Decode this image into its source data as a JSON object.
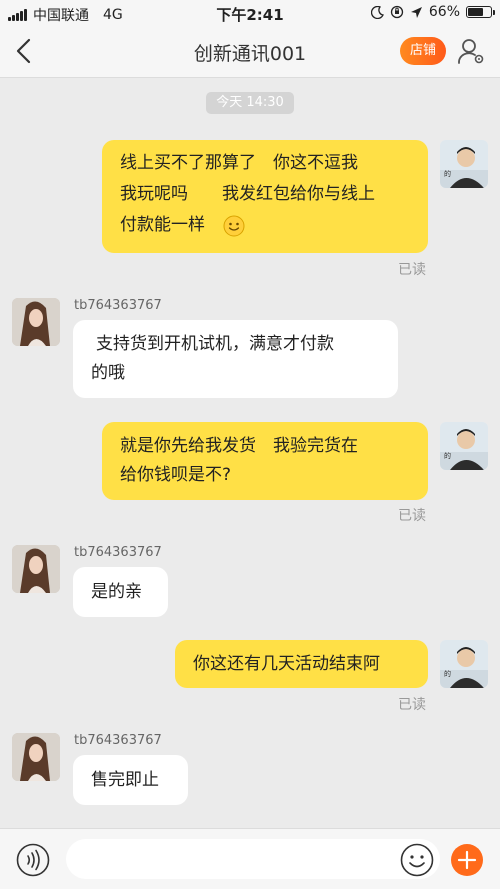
{
  "status_bar": {
    "carrier": "中国联通",
    "network": "4G",
    "time": "下午2:41",
    "battery": "66%",
    "battery_level": 0.66
  },
  "nav": {
    "title": "创新通讯001",
    "shop_label": "店铺",
    "icons": [
      "back-icon",
      "user-settings-icon"
    ]
  },
  "chat": {
    "timestamp": "今天 14:30",
    "read_label": "已读",
    "messages": [
      {
        "direction": "out",
        "lines": [
          "线上买不了那算了　你这不逗我",
          "我玩呢吗　　我发红包给你与线上",
          "付款能一样"
        ],
        "emoji": "smile",
        "status": "已读"
      },
      {
        "direction": "in",
        "sender": "tb764363767",
        "lines": [
          "支持货到开机试机，满意才付款",
          "的哦"
        ]
      },
      {
        "direction": "out",
        "lines": [
          "就是你先给我发货　我验完货在",
          "给你钱呗是不?"
        ],
        "status": "已读"
      },
      {
        "direction": "in",
        "sender": "tb764363767",
        "lines": [
          "是的亲"
        ]
      },
      {
        "direction": "out",
        "lines": [
          "你这还有几天活动结束阿"
        ],
        "status": "已读"
      },
      {
        "direction": "in",
        "sender": "tb764363767",
        "lines": [
          "售完即止"
        ]
      }
    ]
  },
  "input_bar": {
    "placeholder": "",
    "icons": [
      "voice-icon",
      "emoji-icon",
      "plus-icon"
    ],
    "accent": "#ff6a1a"
  },
  "colors": {
    "outgoing_bubble": "#ffe046",
    "incoming_bubble": "#ffffff",
    "background": "#ebebeb"
  }
}
